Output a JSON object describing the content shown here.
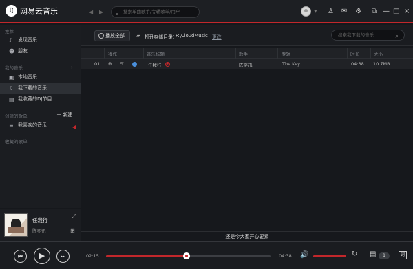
{
  "app": {
    "title": "网易云音乐",
    "search_placeholder": "搜索单曲歌手/专辑歌单/用户"
  },
  "sidebar": {
    "recommend": "推荐",
    "items": [
      {
        "label": "发现音乐",
        "icon": "music-note-icon"
      },
      {
        "label": "朋友",
        "icon": "friends-icon"
      },
      {
        "label": "本地音乐",
        "icon": "local-music-icon"
      },
      {
        "label": "我下载的音乐",
        "icon": "download-icon"
      },
      {
        "label": "我收藏的DJ节目",
        "icon": "radio-icon"
      },
      {
        "label": "我喜欢的音乐",
        "icon": "playlist-icon"
      }
    ],
    "my_music": "我的音乐",
    "created_playlists": "创建的歌单",
    "new_button": "新建",
    "favorited_playlists": "收藏的歌单"
  },
  "toolbar": {
    "play_all": "播放全部",
    "path_label": "打开存储目录：",
    "path_value": "F:\\CloudMusic",
    "change": "更改",
    "search_placeholder": "搜索我下载的音乐"
  },
  "table": {
    "headers": [
      "操作",
      "音乐标题",
      "歌手",
      "专辑",
      "时长",
      "大小"
    ],
    "rows": [
      {
        "index": "01",
        "title": "任我行",
        "artist": "陈奕迅",
        "album": "The Key",
        "duration": "04:38",
        "size": "10.7MB"
      }
    ]
  },
  "now_playing": {
    "title": "任我行",
    "artist": "陈奕迅",
    "status": "还是今大家开心要紧"
  },
  "player": {
    "elapsed": "02:15",
    "total": "04:38",
    "progress": 0.49,
    "volume": 1,
    "playlist_count": "1"
  }
}
